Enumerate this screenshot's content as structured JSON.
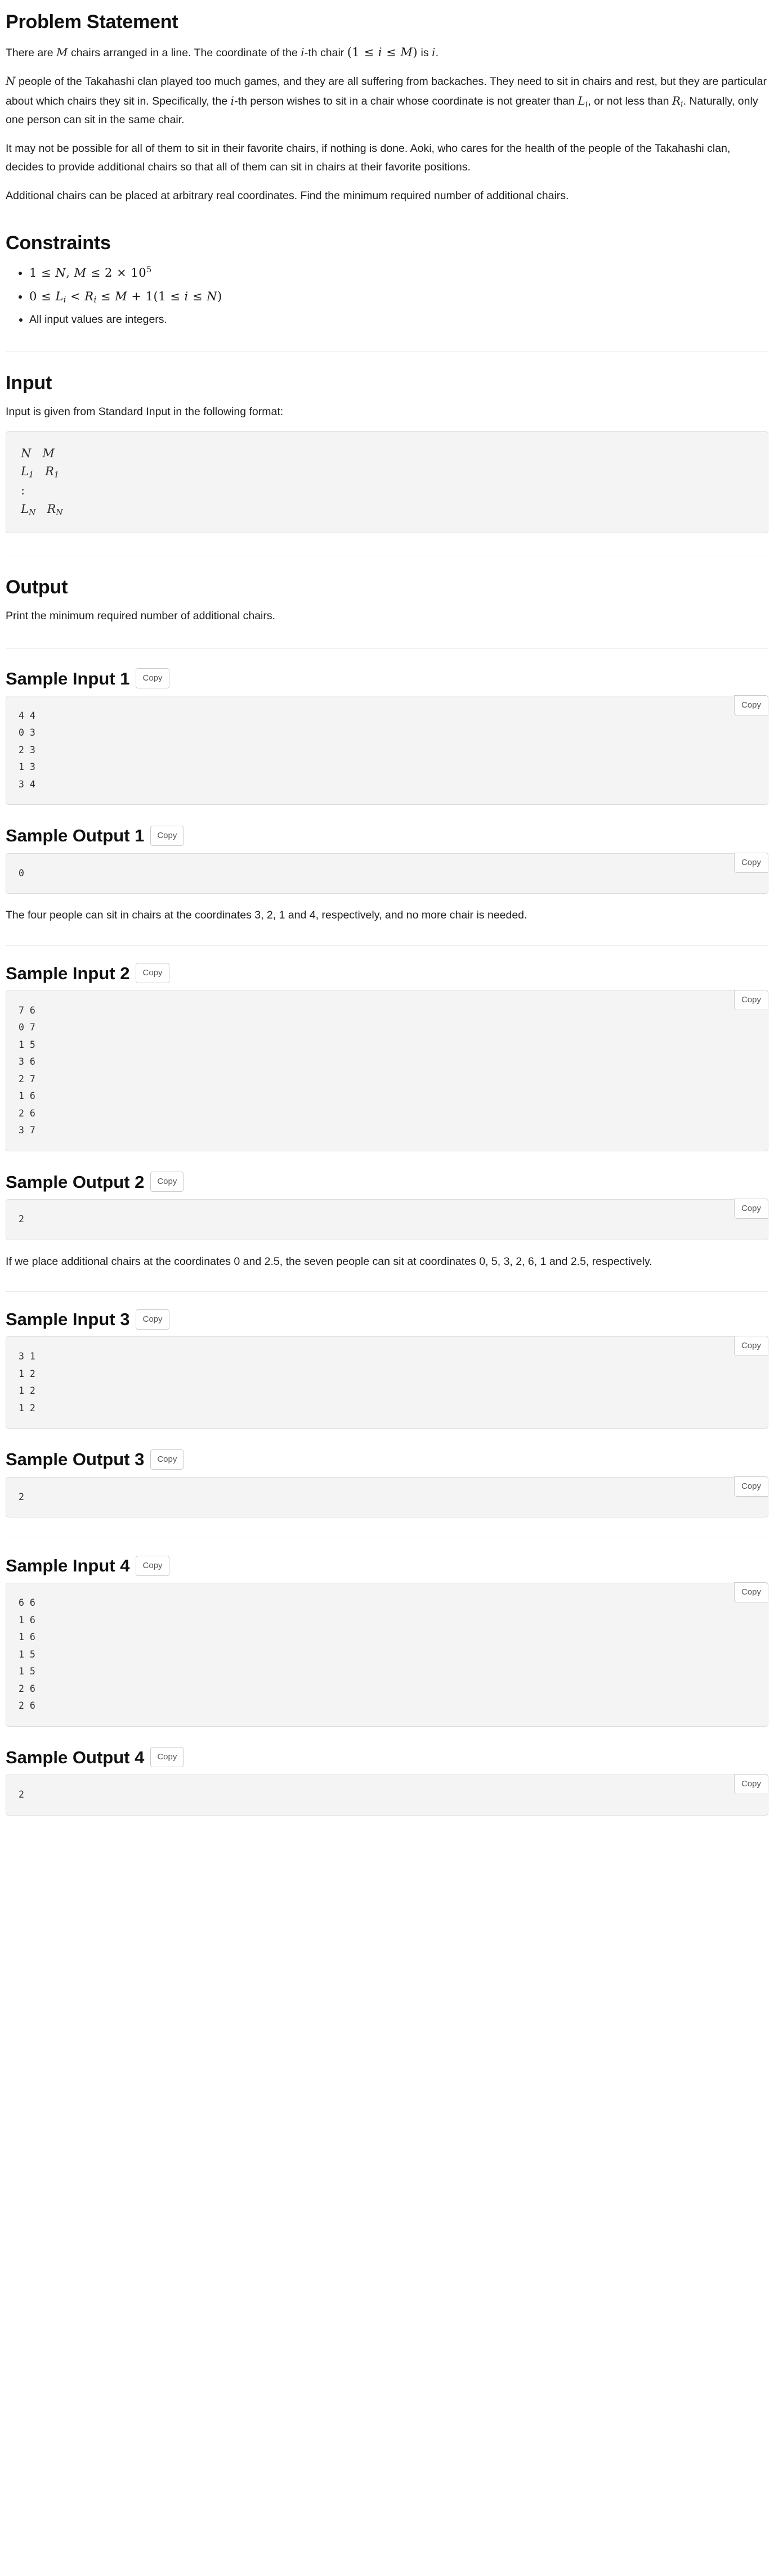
{
  "problem": {
    "heading": "Problem Statement",
    "paragraphs": [
      {
        "id": "p1",
        "parts": [
          {
            "t": "text",
            "v": "There are "
          },
          {
            "t": "math",
            "v": "M"
          },
          {
            "t": "text",
            "v": " chairs arranged in a line. The coordinate of the "
          },
          {
            "t": "math",
            "v": "i"
          },
          {
            "t": "text",
            "v": "-th chair "
          },
          {
            "t": "mathexpr",
            "v": "(1 ≤ i ≤ M)"
          },
          {
            "t": "text",
            "v": " is "
          },
          {
            "t": "math",
            "v": "i"
          },
          {
            "t": "text",
            "v": "."
          }
        ],
        "plain": "There are M chairs arranged in a line. The coordinate of the i-th chair (1 ≤ i ≤ M) is i."
      },
      {
        "id": "p2",
        "plain": "N people of the Takahashi clan played too much games, and they are all suffering from backaches. They need to sit in chairs and rest, but they are particular about which chairs they sit in. Specifically, the i-th person wishes to sit in a chair whose coordinate is not greater than L_i, or not less than R_i. Naturally, only one person can sit in the same chair."
      },
      {
        "id": "p3",
        "plain": "It may not be possible for all of them to sit in their favorite chairs, if nothing is done. Aoki, who cares for the health of the people of the Takahashi clan, decides to provide additional chairs so that all of them can sit in chairs at their favorite positions."
      },
      {
        "id": "p4",
        "plain": "Additional chairs can be placed at arbitrary real coordinates. Find the minimum required number of additional chairs."
      }
    ]
  },
  "constraints": {
    "heading": "Constraints",
    "items": [
      {
        "kind": "math",
        "text": "1 ≤ N, M ≤ 2 × 10^5"
      },
      {
        "kind": "math",
        "text": "0 ≤ L_i < R_i ≤ M + 1 (1 ≤ i ≤ N)"
      },
      {
        "kind": "plain",
        "text": "All input values are integers."
      }
    ]
  },
  "input": {
    "heading": "Input",
    "intro": "Input is given from Standard Input in the following format:",
    "format_lines": [
      "N   M",
      "L_1   R_1",
      ":",
      "L_N   R_N"
    ]
  },
  "output": {
    "heading": "Output",
    "text": "Print the minimum required number of additional chairs."
  },
  "copy_label": "Copy",
  "samples": [
    {
      "input_heading": "Sample Input 1",
      "input_code": "4 4\n0 3\n2 3\n1 3\n3 4",
      "output_heading": "Sample Output 1",
      "output_code": "0",
      "explanation": "The four people can sit in chairs at the coordinates 3, 2, 1 and 4, respectively, and no more chair is needed."
    },
    {
      "input_heading": "Sample Input 2",
      "input_code": "7 6\n0 7\n1 5\n3 6\n2 7\n1 6\n2 6\n3 7",
      "output_heading": "Sample Output 2",
      "output_code": "2",
      "explanation": "If we place additional chairs at the coordinates 0 and 2.5, the seven people can sit at coordinates 0, 5, 3, 2, 6, 1 and 2.5, respectively."
    },
    {
      "input_heading": "Sample Input 3",
      "input_code": "3 1\n1 2\n1 2\n1 2",
      "output_heading": "Sample Output 3",
      "output_code": "2",
      "explanation": ""
    },
    {
      "input_heading": "Sample Input 4",
      "input_code": "6 6\n1 6\n1 6\n1 5\n1 5\n2 6\n2 6",
      "output_heading": "Sample Output 4",
      "output_code": "2",
      "explanation": ""
    }
  ]
}
